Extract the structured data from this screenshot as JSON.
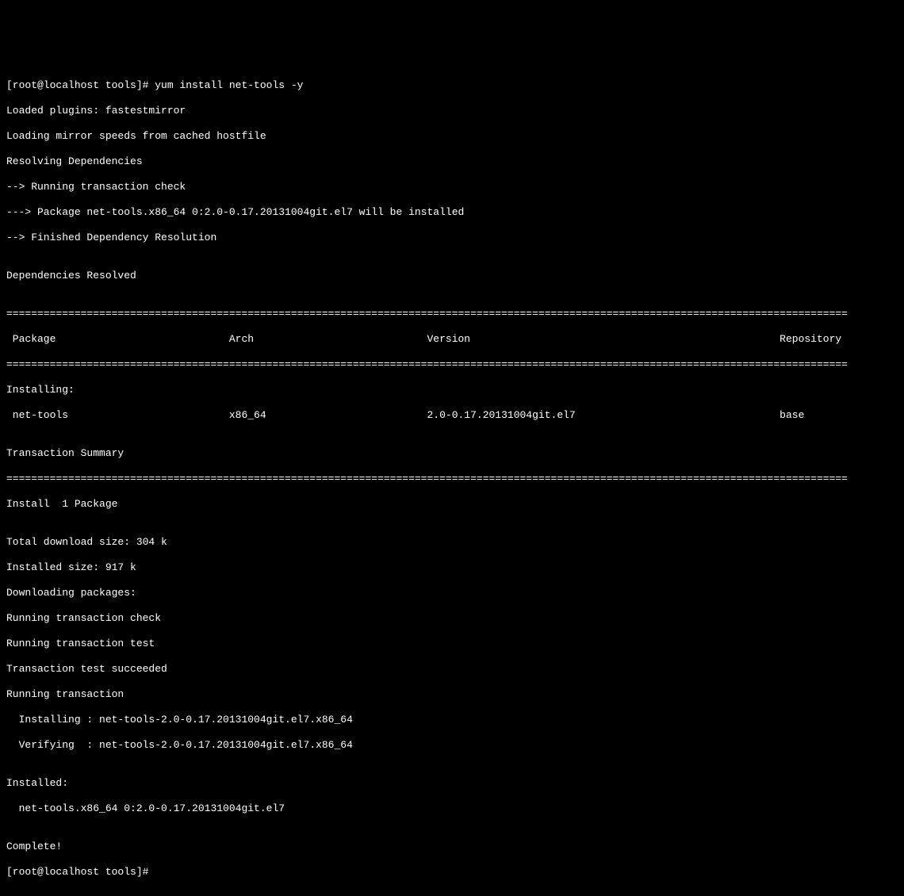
{
  "top_fragment_red": "                         ",
  "prompt1_user": "[root@localhost tools]# ",
  "prompt1_cmd": "yum install net-tools -y",
  "loaded_plugins": "Loaded plugins: fastestmirror",
  "loading_mirror": "Loading mirror speeds from cached hostfile",
  "resolving": "Resolving Dependencies",
  "running_check": "--> Running transaction check",
  "package_install": "---> Package net-tools.x86_64 0:2.0-0.17.20131004git.el7 will be installed",
  "finished_dep": "--> Finished Dependency Resolution",
  "blank": "",
  "deps_resolved": "Dependencies Resolved",
  "sep": "========================================================================================================================================",
  "header_row": " Package                            Arch                            Version                                                  Repository",
  "installing_hdr": "Installing:",
  "pkg_row": " net-tools                          x86_64                          2.0-0.17.20131004git.el7                                 base",
  "tx_summary": "Transaction Summary",
  "install_count": "Install  1 Package",
  "total_dl": "Total download size: 304 k",
  "installed_size": "Installed size: 917 k",
  "downloading": "Downloading packages:",
  "run_tx_check": "Running transaction check",
  "run_tx_test": "Running transaction test",
  "tx_test_ok": "Transaction test succeeded",
  "run_tx": "Running transaction",
  "installing_line": "  Installing : net-tools-2.0-0.17.20131004git.el7.x86_64",
  "verifying_line": "  Verifying  : net-tools-2.0-0.17.20131004git.el7.x86_64",
  "installed_hdr": "Installed:",
  "installed_pkg": "  net-tools.x86_64 0:2.0-0.17.20131004git.el7",
  "complete": "Complete!",
  "prompt2_user": "[root@localhost tools]# "
}
